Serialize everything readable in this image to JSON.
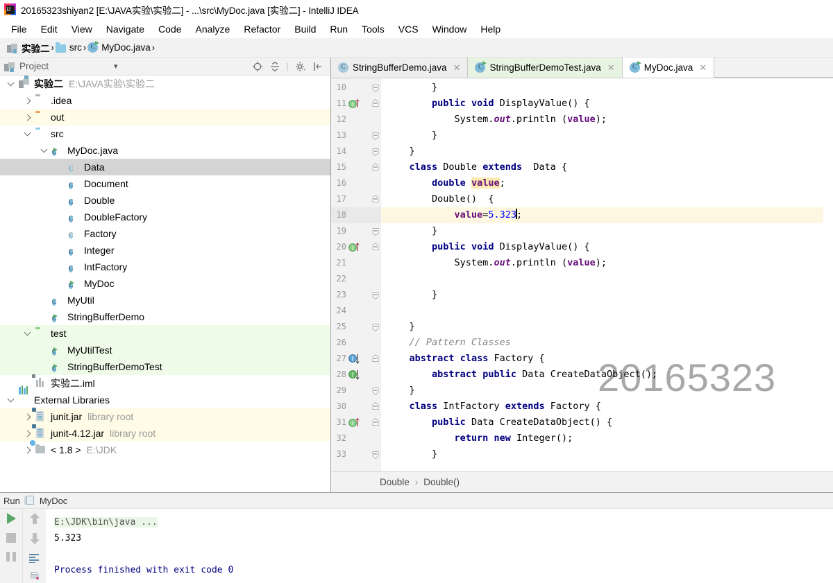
{
  "window": {
    "title": "20165323shiyan2 [E:\\JAVA实验\\实验二] - ...\\src\\MyDoc.java [实验二] - IntelliJ IDEA",
    "logo_icon": "intellij-idea-logo"
  },
  "menubar": {
    "items": [
      {
        "label": "File"
      },
      {
        "label": "Edit"
      },
      {
        "label": "View"
      },
      {
        "label": "Navigate"
      },
      {
        "label": "Code"
      },
      {
        "label": "Analyze"
      },
      {
        "label": "Refactor"
      },
      {
        "label": "Build"
      },
      {
        "label": "Run"
      },
      {
        "label": "Tools"
      },
      {
        "label": "VCS"
      },
      {
        "label": "Window"
      },
      {
        "label": "Help"
      }
    ]
  },
  "navbar": {
    "crumbs": [
      {
        "label": "实验二",
        "icon": "project-module-icon"
      },
      {
        "label": "src",
        "icon": "folder-blue-icon"
      },
      {
        "label": "MyDoc.java",
        "icon": "java-class-icon"
      }
    ],
    "separator": "›"
  },
  "sidebar": {
    "header": {
      "title": "Project",
      "icon": "project-view-icon",
      "chevron": "▾"
    },
    "tools": [
      {
        "name": "locate-icon"
      },
      {
        "name": "collapse-all-icon"
      },
      {
        "name": "settings-gear-icon"
      },
      {
        "name": "hide-panel-icon"
      }
    ],
    "tree": [
      {
        "label": "实验二",
        "sub": "E:\\JAVA实验\\实验二",
        "indent": 0,
        "arrow": "down",
        "icon": "project-module-icon",
        "bold": true,
        "row_style": "none"
      },
      {
        "label": ".idea",
        "sub": "",
        "indent": 1,
        "arrow": "right",
        "icon": "folder-gray-icon",
        "bold": false,
        "row_style": "none"
      },
      {
        "label": "out",
        "sub": "",
        "indent": 1,
        "arrow": "right",
        "icon": "folder-orange-icon",
        "bold": false,
        "row_style": "yellow"
      },
      {
        "label": "src",
        "sub": "",
        "indent": 1,
        "arrow": "down",
        "icon": "folder-blue-icon",
        "bold": false,
        "row_style": "none"
      },
      {
        "label": "MyDoc.java",
        "sub": "",
        "indent": 2,
        "arrow": "down",
        "icon": "java-class-runnable-icon",
        "bold": false,
        "row_style": "none"
      },
      {
        "label": "Data",
        "sub": "",
        "indent": 3,
        "arrow": "none",
        "icon": "java-class-abstract-icon",
        "bold": false,
        "row_style": "selected"
      },
      {
        "label": "Document",
        "sub": "",
        "indent": 3,
        "arrow": "none",
        "icon": "java-class-icon",
        "bold": false,
        "row_style": "none"
      },
      {
        "label": "Double",
        "sub": "",
        "indent": 3,
        "arrow": "none",
        "icon": "java-class-icon",
        "bold": false,
        "row_style": "none"
      },
      {
        "label": "DoubleFactory",
        "sub": "",
        "indent": 3,
        "arrow": "none",
        "icon": "java-class-icon",
        "bold": false,
        "row_style": "none"
      },
      {
        "label": "Factory",
        "sub": "",
        "indent": 3,
        "arrow": "none",
        "icon": "java-class-abstract-icon",
        "bold": false,
        "row_style": "none"
      },
      {
        "label": "Integer",
        "sub": "",
        "indent": 3,
        "arrow": "none",
        "icon": "java-class-icon",
        "bold": false,
        "row_style": "none"
      },
      {
        "label": "IntFactory",
        "sub": "",
        "indent": 3,
        "arrow": "none",
        "icon": "java-class-icon",
        "bold": false,
        "row_style": "none"
      },
      {
        "label": "MyDoc",
        "sub": "",
        "indent": 3,
        "arrow": "none",
        "icon": "java-class-runnable-icon",
        "bold": false,
        "row_style": "none"
      },
      {
        "label": "MyUtil",
        "sub": "",
        "indent": 2,
        "arrow": "none",
        "icon": "java-class-icon",
        "bold": false,
        "row_style": "none"
      },
      {
        "label": "StringBufferDemo",
        "sub": "",
        "indent": 2,
        "arrow": "none",
        "icon": "java-class-runnable-icon",
        "bold": false,
        "row_style": "none"
      },
      {
        "label": "test",
        "sub": "",
        "indent": 1,
        "arrow": "down",
        "icon": "folder-green-icon",
        "bold": false,
        "row_style": "green"
      },
      {
        "label": "MyUtilTest",
        "sub": "",
        "indent": 2,
        "arrow": "none",
        "icon": "java-class-runnable-icon",
        "bold": false,
        "row_style": "green"
      },
      {
        "label": "StringBufferDemoTest",
        "sub": "",
        "indent": 2,
        "arrow": "none",
        "icon": "java-class-runnable-icon",
        "bold": false,
        "row_style": "green"
      },
      {
        "label": "实验二.iml",
        "sub": "",
        "indent": 1,
        "arrow": "none",
        "icon": "iml-module-file-icon",
        "bold": false,
        "row_style": "none"
      },
      {
        "label": "External Libraries",
        "sub": "",
        "indent": 0,
        "arrow": "down",
        "icon": "external-libraries-icon",
        "bold": false,
        "row_style": "none"
      },
      {
        "label": "junit.jar",
        "sub": "library root",
        "indent": 1,
        "arrow": "right",
        "icon": "jar-icon",
        "bold": false,
        "row_style": "yellow"
      },
      {
        "label": "junit-4.12.jar",
        "sub": "library root",
        "indent": 1,
        "arrow": "right",
        "icon": "jar-icon",
        "bold": false,
        "row_style": "yellow"
      },
      {
        "label": "< 1.8 >",
        "sub": "E:\\JDK",
        "indent": 1,
        "arrow": "right",
        "icon": "jdk-icon",
        "bold": false,
        "row_style": "none"
      }
    ]
  },
  "editor": {
    "tabs": [
      {
        "label": "StringBufferDemo.java",
        "icon": "java-class-icon",
        "state": "gray",
        "close": "✕"
      },
      {
        "label": "StringBufferDemoTest.java",
        "icon": "java-class-runnable-icon",
        "state": "green",
        "close": "✕"
      },
      {
        "label": "MyDoc.java",
        "icon": "java-class-runnable-icon",
        "state": "active",
        "close": "✕"
      }
    ],
    "watermark": "20165323",
    "caret_line": 18,
    "lines": [
      {
        "num": "10",
        "gutter_icon": "",
        "fold": "end",
        "tokens": [
          {
            "t": "        }",
            "c": "plain"
          }
        ]
      },
      {
        "num": "11",
        "gutter_icon": "override-up",
        "fold": "start",
        "tokens": [
          {
            "t": "        ",
            "c": "plain"
          },
          {
            "t": "public",
            "c": "kw"
          },
          {
            "t": " ",
            "c": "plain"
          },
          {
            "t": "void",
            "c": "kw"
          },
          {
            "t": " DisplayValue() {",
            "c": "plain"
          }
        ]
      },
      {
        "num": "12",
        "gutter_icon": "",
        "fold": "",
        "tokens": [
          {
            "t": "            System.",
            "c": "plain"
          },
          {
            "t": "out",
            "c": "stat"
          },
          {
            "t": ".println (",
            "c": "plain"
          },
          {
            "t": "value",
            "c": "fld"
          },
          {
            "t": ");",
            "c": "plain"
          }
        ]
      },
      {
        "num": "13",
        "gutter_icon": "",
        "fold": "end",
        "tokens": [
          {
            "t": "        }",
            "c": "plain"
          }
        ]
      },
      {
        "num": "14",
        "gutter_icon": "",
        "fold": "end",
        "tokens": [
          {
            "t": "    }",
            "c": "plain"
          }
        ]
      },
      {
        "num": "15",
        "gutter_icon": "",
        "fold": "start",
        "tokens": [
          {
            "t": "    ",
            "c": "plain"
          },
          {
            "t": "class",
            "c": "kw"
          },
          {
            "t": " Double ",
            "c": "plain"
          },
          {
            "t": "extends",
            "c": "kw"
          },
          {
            "t": "  Data {",
            "c": "plain"
          }
        ]
      },
      {
        "num": "16",
        "gutter_icon": "",
        "fold": "",
        "tokens": [
          {
            "t": "        ",
            "c": "plain"
          },
          {
            "t": "double",
            "c": "kw"
          },
          {
            "t": " ",
            "c": "plain"
          },
          {
            "t": "value",
            "c": "hlid"
          },
          {
            "t": ";",
            "c": "plain"
          }
        ]
      },
      {
        "num": "17",
        "gutter_icon": "",
        "fold": "start",
        "tokens": [
          {
            "t": "        Double()  {",
            "c": "plain"
          }
        ]
      },
      {
        "num": "18",
        "gutter_icon": "",
        "fold": "",
        "highlight": true,
        "tokens": [
          {
            "t": "            ",
            "c": "plain"
          },
          {
            "t": "value",
            "c": "fld"
          },
          {
            "t": "=",
            "c": "plain"
          },
          {
            "t": "5.323",
            "c": "num"
          },
          {
            "t": "CARET",
            "c": "caret"
          },
          {
            "t": ";",
            "c": "plain"
          }
        ]
      },
      {
        "num": "19",
        "gutter_icon": "",
        "fold": "end",
        "tokens": [
          {
            "t": "        }",
            "c": "plain"
          }
        ]
      },
      {
        "num": "20",
        "gutter_icon": "override-up",
        "fold": "start",
        "tokens": [
          {
            "t": "        ",
            "c": "plain"
          },
          {
            "t": "public",
            "c": "kw"
          },
          {
            "t": " ",
            "c": "plain"
          },
          {
            "t": "void",
            "c": "kw"
          },
          {
            "t": " DisplayValue() {",
            "c": "plain"
          }
        ]
      },
      {
        "num": "21",
        "gutter_icon": "",
        "fold": "",
        "tokens": [
          {
            "t": "            System.",
            "c": "plain"
          },
          {
            "t": "out",
            "c": "stat"
          },
          {
            "t": ".println (",
            "c": "plain"
          },
          {
            "t": "value",
            "c": "fld"
          },
          {
            "t": ");",
            "c": "plain"
          }
        ]
      },
      {
        "num": "22",
        "gutter_icon": "",
        "fold": "",
        "tokens": [
          {
            "t": "",
            "c": "plain"
          }
        ]
      },
      {
        "num": "23",
        "gutter_icon": "",
        "fold": "end",
        "tokens": [
          {
            "t": "        }",
            "c": "plain"
          }
        ]
      },
      {
        "num": "24",
        "gutter_icon": "",
        "fold": "",
        "tokens": [
          {
            "t": "",
            "c": "plain"
          }
        ]
      },
      {
        "num": "25",
        "gutter_icon": "",
        "fold": "end",
        "tokens": [
          {
            "t": "    }",
            "c": "plain"
          }
        ]
      },
      {
        "num": "26",
        "gutter_icon": "",
        "fold": "",
        "tokens": [
          {
            "t": "    // Pattern Classes",
            "c": "cmt"
          }
        ]
      },
      {
        "num": "27",
        "gutter_icon": "implemented-down-blue",
        "fold": "start",
        "tokens": [
          {
            "t": "    ",
            "c": "plain"
          },
          {
            "t": "abstract",
            "c": "kw"
          },
          {
            "t": " ",
            "c": "plain"
          },
          {
            "t": "class",
            "c": "kw"
          },
          {
            "t": " Factory {",
            "c": "plain"
          }
        ]
      },
      {
        "num": "28",
        "gutter_icon": "implemented-down-green",
        "fold": "",
        "tokens": [
          {
            "t": "        ",
            "c": "plain"
          },
          {
            "t": "abstract",
            "c": "kw"
          },
          {
            "t": " ",
            "c": "plain"
          },
          {
            "t": "public",
            "c": "kw"
          },
          {
            "t": " Data CreateDataObject();",
            "c": "plain"
          }
        ]
      },
      {
        "num": "29",
        "gutter_icon": "",
        "fold": "end",
        "tokens": [
          {
            "t": "    }",
            "c": "plain"
          }
        ]
      },
      {
        "num": "30",
        "gutter_icon": "",
        "fold": "start",
        "tokens": [
          {
            "t": "    ",
            "c": "plain"
          },
          {
            "t": "class",
            "c": "kw"
          },
          {
            "t": " IntFactory ",
            "c": "plain"
          },
          {
            "t": "extends",
            "c": "kw"
          },
          {
            "t": " Factory {",
            "c": "plain"
          }
        ]
      },
      {
        "num": "31",
        "gutter_icon": "override-up",
        "fold": "start",
        "tokens": [
          {
            "t": "        ",
            "c": "plain"
          },
          {
            "t": "public",
            "c": "kw"
          },
          {
            "t": " Data CreateDataObject() {",
            "c": "plain"
          }
        ]
      },
      {
        "num": "32",
        "gutter_icon": "",
        "fold": "",
        "tokens": [
          {
            "t": "            ",
            "c": "plain"
          },
          {
            "t": "return",
            "c": "kw"
          },
          {
            "t": " ",
            "c": "plain"
          },
          {
            "t": "new",
            "c": "kw"
          },
          {
            "t": " Integer();",
            "c": "plain"
          }
        ]
      },
      {
        "num": "33",
        "gutter_icon": "",
        "fold": "end",
        "tokens": [
          {
            "t": "        }",
            "c": "plain"
          }
        ]
      }
    ],
    "breadcrumbs": [
      {
        "label": "Double"
      },
      {
        "label": "Double()"
      }
    ],
    "breadcrumb_separator": "›"
  },
  "run_panel": {
    "title": "Run",
    "config_name": "MyDoc",
    "config_icon": "run-config-icon",
    "left_tools": [
      {
        "name": "rerun-play-icon"
      },
      {
        "name": "stop-icon"
      },
      {
        "name": "pause-icon"
      }
    ],
    "right_tools": [
      {
        "name": "arrow-up-icon"
      },
      {
        "name": "arrow-down-icon"
      },
      {
        "name": "soft-wrap-icon"
      },
      {
        "name": "print-icon"
      }
    ],
    "console": [
      {
        "text": "E:\\JDK\\bin\\java ...",
        "style": "cmd"
      },
      {
        "text": "5.323",
        "style": "out"
      },
      {
        "text": "",
        "style": "out"
      },
      {
        "text": "Process finished with exit code 0",
        "style": "fin"
      }
    ]
  },
  "colors": {
    "accent_green": "#59a869",
    "accent_blue": "#62b5e5",
    "keyword": "#000080",
    "field": "#660e7a",
    "number": "#0000ff",
    "comment": "#808080",
    "selection": "#d4d4d4",
    "caret_line": "#fdf7e2",
    "test_green": "#effbe9",
    "lib_yellow": "#fefbe6"
  }
}
